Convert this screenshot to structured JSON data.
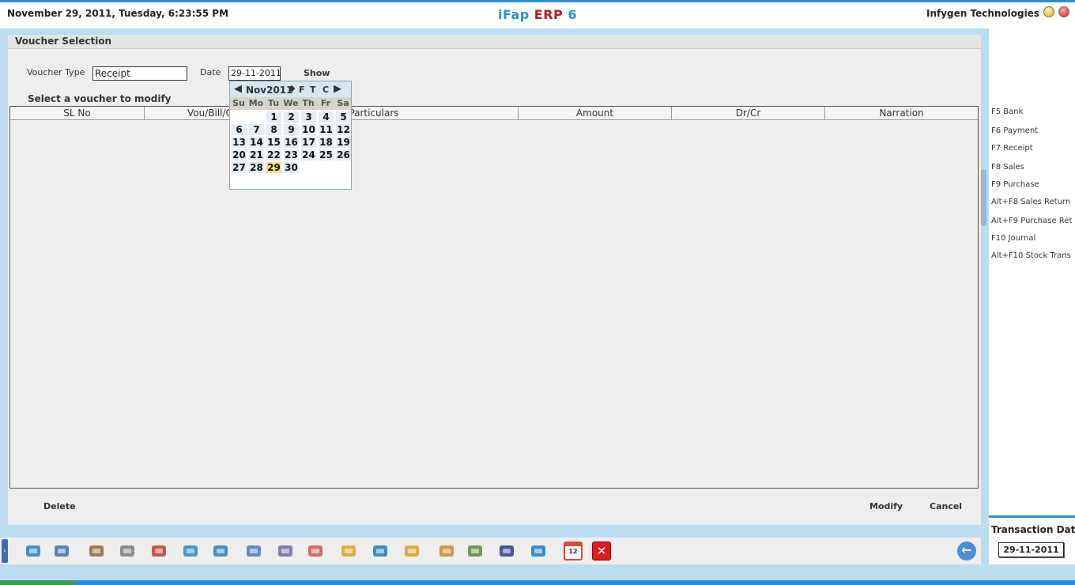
{
  "topbar": {
    "datetime": "November  29, 2011, Tuesday, 6:23:55 PM",
    "title_part1": "iFap",
    "title_part2": "ERP",
    "title_part3": "6",
    "company": "Infygen Technologies"
  },
  "panel": {
    "title": "Voucher Selection",
    "voucher_type_label": "Voucher Type",
    "voucher_type_value": "Receipt",
    "date_label": "Date",
    "date_value": "29-11-2011",
    "show_label": "Show",
    "subheading": "Select a voucher to modify"
  },
  "grid": {
    "columns": [
      "SL No",
      "Vou/Bill/Ch",
      "Particulars",
      "Amount",
      "Dr/Cr",
      "Narration"
    ]
  },
  "calendar": {
    "month_label": "Nov2011",
    "letters": [
      "F",
      "T",
      "C"
    ],
    "prev": "◀",
    "next": "▶",
    "spin": "◆",
    "dow": [
      "Su",
      "Mo",
      "Tu",
      "We",
      "Th",
      "Fr",
      "Sa"
    ],
    "weeks": [
      [
        "",
        "",
        "1",
        "2",
        "3",
        "4",
        "5"
      ],
      [
        "6",
        "7",
        "8",
        "9",
        "10",
        "11",
        "12"
      ],
      [
        "13",
        "14",
        "15",
        "16",
        "17",
        "18",
        "19"
      ],
      [
        "20",
        "21",
        "22",
        "23",
        "24",
        "25",
        "26"
      ],
      [
        "27",
        "28",
        "29",
        "30",
        "",
        "",
        ""
      ]
    ],
    "selected_day": "29"
  },
  "actions": {
    "delete": "Delete",
    "modify": "Modify",
    "cancel": "Cancel"
  },
  "shortcuts": [
    "F5 Bank",
    "F6 Payment",
    "F7 Receipt",
    "F8 Sales",
    "F9 Purchase",
    "Alt+F8 Sales Return",
    "Alt+F9 Purchase Ret",
    "F10 Journal",
    "Alt+F10 Stock Trans"
  ],
  "transaction": {
    "label": "Transaction Date",
    "value": "29-11-2011"
  },
  "toolbar": {
    "grip_glyph": "‹",
    "back_glyph": "←",
    "calendar_icon_text": "12",
    "close_icon_text": "✕",
    "icons": [
      {
        "name": "bank-icon",
        "color": "#2a7fc4"
      },
      {
        "name": "user-phone-icon",
        "color": "#3a6fb0"
      },
      {
        "name": "users-icon",
        "color": "#8a6a3a"
      },
      {
        "name": "gears-icon",
        "color": "#7a7a7a"
      },
      {
        "name": "ledger-book-icon",
        "color": "#c0392b"
      },
      {
        "name": "shopping-cart-icon",
        "color": "#2e86c1"
      },
      {
        "name": "transfer-icon",
        "color": "#2980b9"
      },
      {
        "name": "window-icon",
        "color": "#4a78b8"
      },
      {
        "name": "document-icon",
        "color": "#6a6a9a"
      },
      {
        "name": "chart-icon",
        "color": "#d35454"
      },
      {
        "name": "hierarchy-icon",
        "color": "#e0a020"
      },
      {
        "name": "arrows-icon",
        "color": "#1f7ab8"
      },
      {
        "name": "box-icon",
        "color": "#d9a020"
      },
      {
        "name": "calculator-icon",
        "color": "#c8882a"
      },
      {
        "name": "spreadsheet-icon",
        "color": "#5a8a3a"
      },
      {
        "name": "save-disk-icon",
        "color": "#2a3a8a"
      },
      {
        "name": "settings-gear-icon",
        "color": "#1a78c8"
      },
      {
        "name": "calendar-icon",
        "color": "#d84a3a"
      },
      {
        "name": "exit-icon",
        "color": "#d81e1e"
      }
    ]
  }
}
